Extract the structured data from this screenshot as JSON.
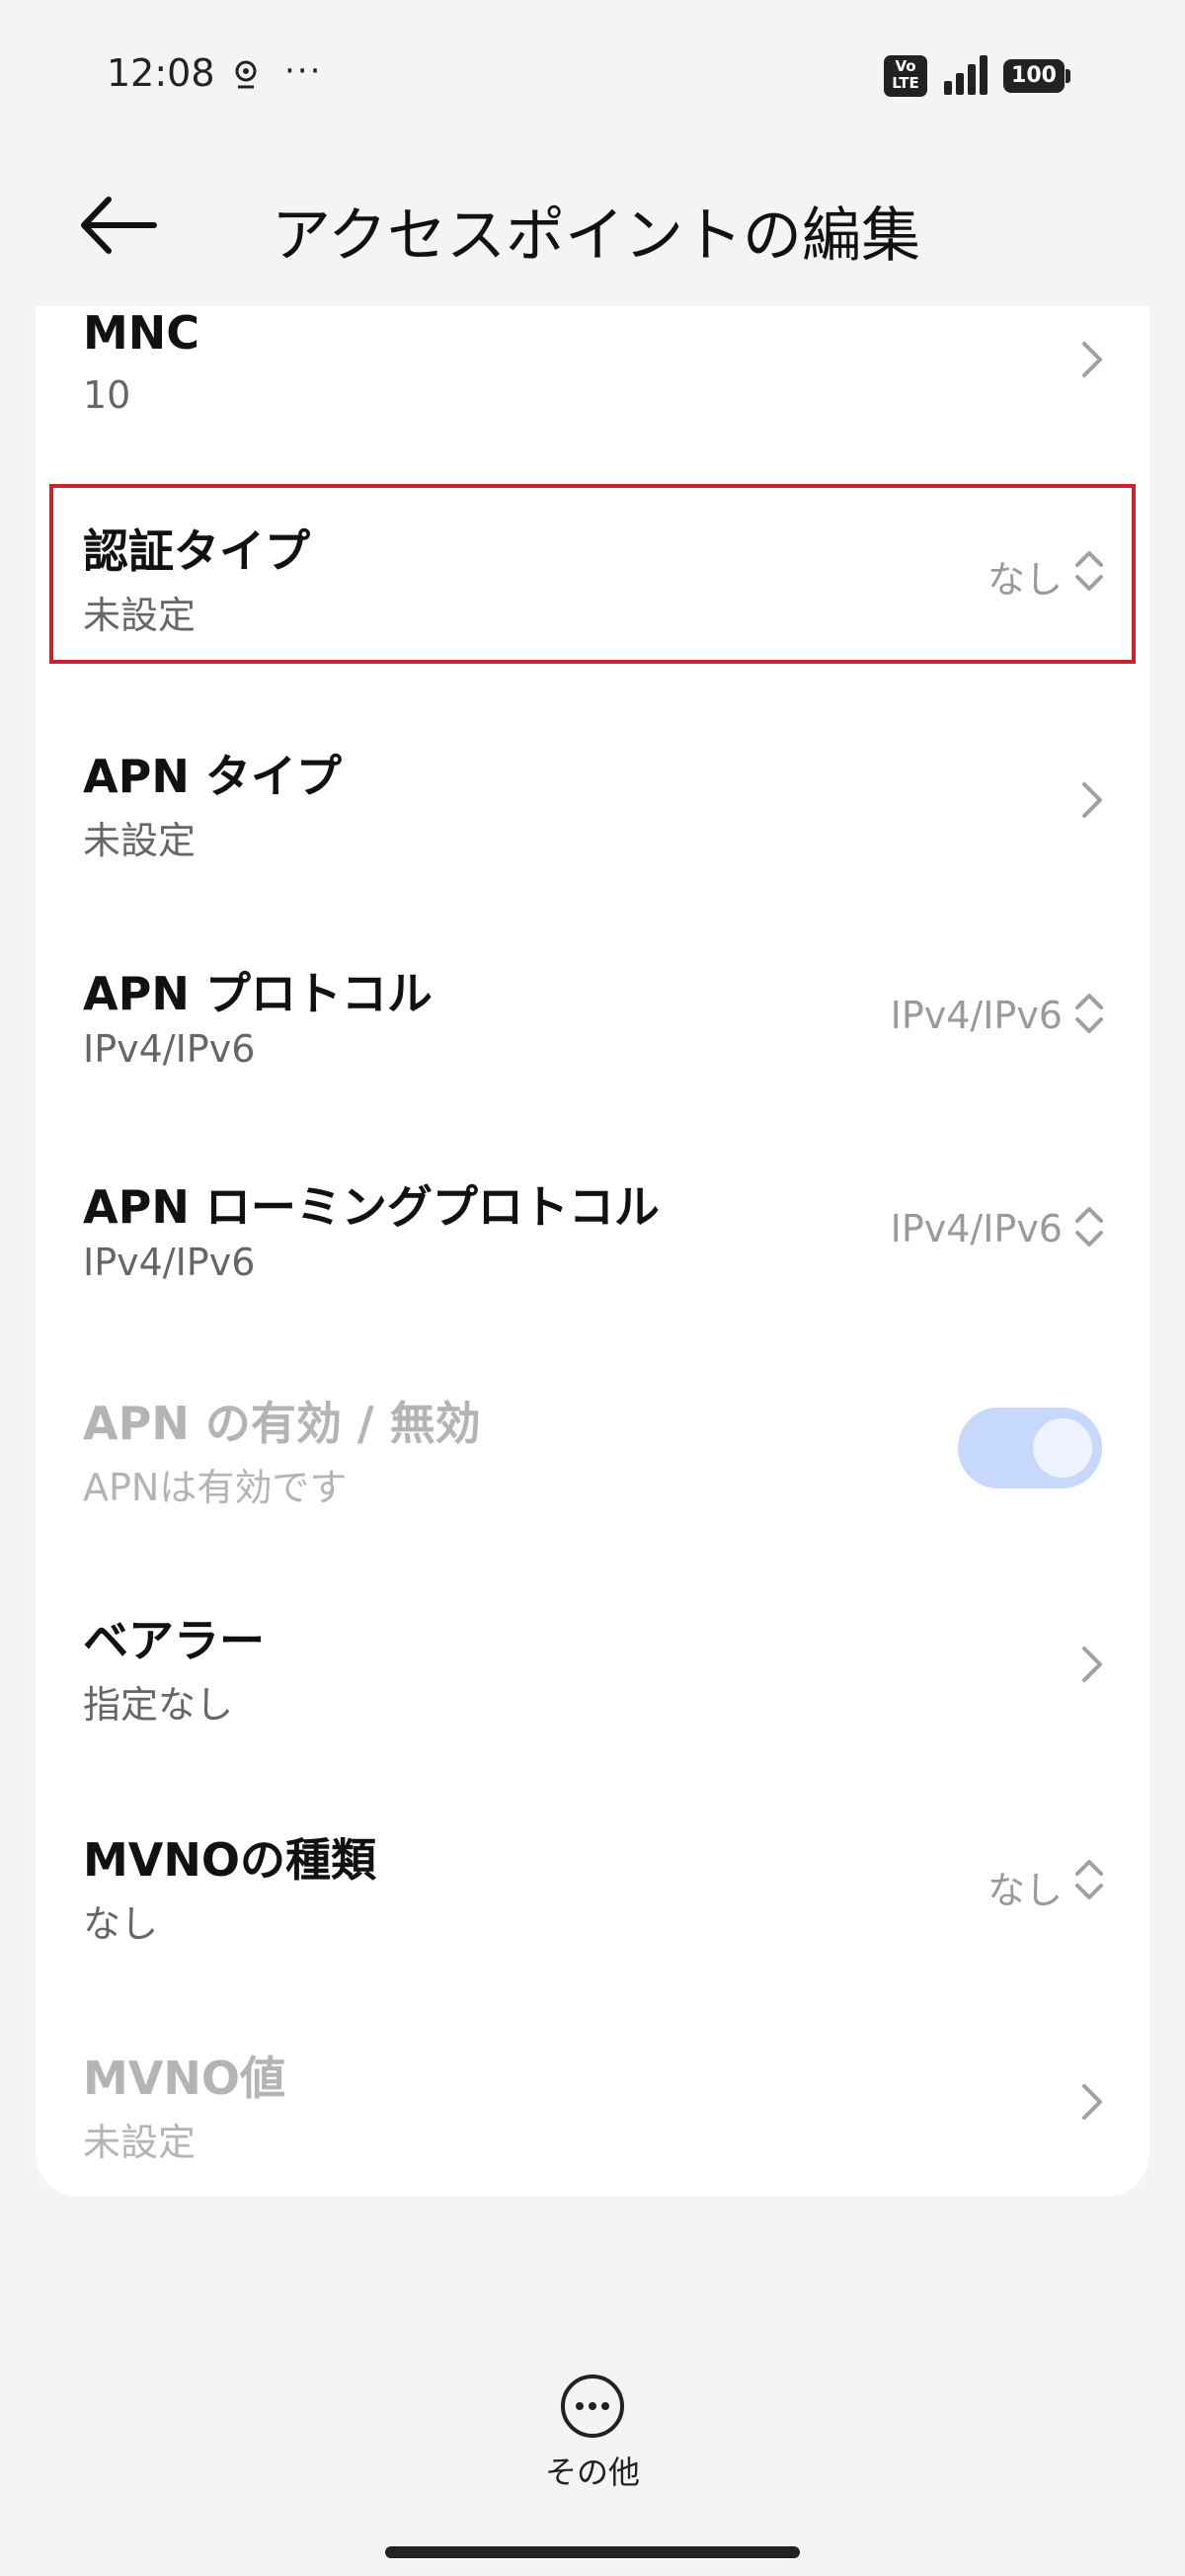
{
  "status_bar": {
    "time": "12:08",
    "more": "···",
    "volte": "Vo\nLTE",
    "battery": "100"
  },
  "header": {
    "title": "アクセスポイントの編集"
  },
  "rows": [
    {
      "title": "MNC",
      "subtitle": "10",
      "value": "",
      "control": "chevron"
    },
    {
      "title": "認証タイプ",
      "subtitle": "未設定",
      "value": "なし",
      "control": "updown",
      "highlighted": true
    },
    {
      "title": "APN タイプ",
      "subtitle": "未設定",
      "value": "",
      "control": "chevron"
    },
    {
      "title": "APN プロトコル",
      "subtitle": "IPv4/IPv6",
      "value": "IPv4/IPv6",
      "control": "updown"
    },
    {
      "title": "APN ローミングプロトコル",
      "subtitle": "IPv4/IPv6",
      "value": "IPv4/IPv6",
      "control": "updown"
    },
    {
      "title": "APN の有効 / 無効",
      "subtitle": "APNは有効です",
      "value": "",
      "control": "toggle",
      "disabled": true,
      "toggle_on": true
    },
    {
      "title": "ベアラー",
      "subtitle": "指定なし",
      "value": "",
      "control": "chevron"
    },
    {
      "title": "MVNOの種類",
      "subtitle": "なし",
      "value": "なし",
      "control": "updown"
    },
    {
      "title": "MVNO値",
      "subtitle": "未設定",
      "value": "",
      "control": "chevron",
      "disabled": true
    }
  ],
  "bottom": {
    "more_label": "その他"
  },
  "colors": {
    "highlight": "#c9232d",
    "toggle": "#c6d8fb",
    "background": "#f4f4f4"
  }
}
